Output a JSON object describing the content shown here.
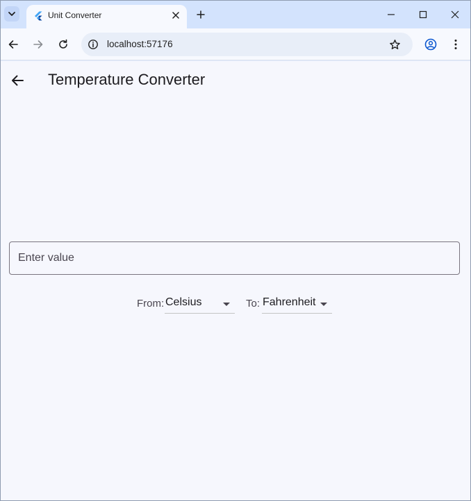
{
  "browser": {
    "tab_title": "Unit Converter",
    "url": "localhost:57176"
  },
  "app": {
    "title": "Temperature Converter",
    "value_input": {
      "placeholder": "Enter value",
      "value": ""
    },
    "from": {
      "label": "From:",
      "selected": "Celsius"
    },
    "to": {
      "label": "To:",
      "selected": "Fahrenheit"
    }
  },
  "icons": {
    "tab_search": "chevron-down-icon",
    "favicon": "flutter-logo-icon",
    "tab_close": "close-icon",
    "new_tab": "plus-icon",
    "minimize": "minimize-icon",
    "maximize": "maximize-icon",
    "close_window": "close-icon",
    "back": "arrow-left-icon",
    "forward": "arrow-right-icon",
    "reload": "reload-icon",
    "site_info": "info-icon",
    "bookmark": "star-icon",
    "profile": "profile-icon",
    "menu": "kebab-menu-icon",
    "app_back": "arrow-left-icon",
    "dropdown": "caret-down-icon"
  },
  "colors": {
    "tab_strip": "#d3e3fd",
    "toolbar": "#f7f9fe",
    "app_background": "#f6f7fd",
    "profile_accent": "#0b57d0",
    "flutter_blue": "#42a5f5"
  }
}
